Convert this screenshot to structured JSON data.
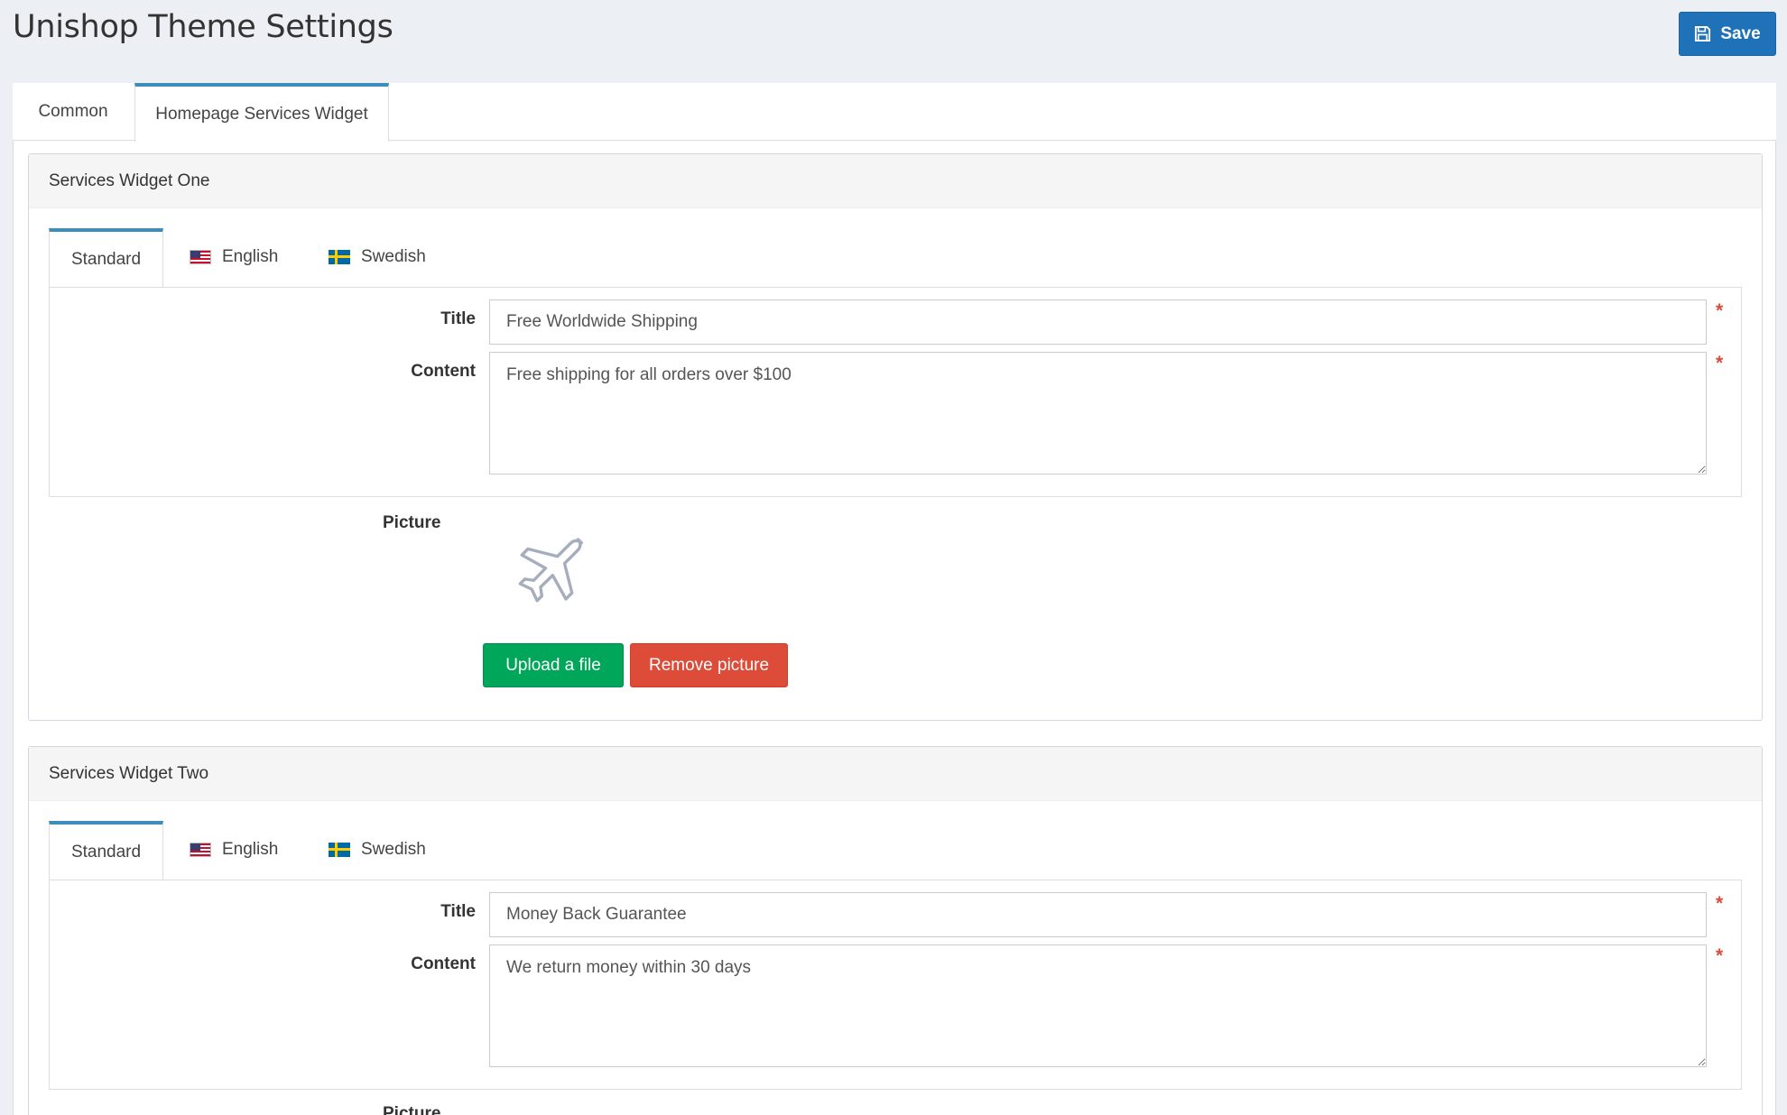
{
  "header": {
    "title": "Unishop Theme Settings",
    "save_label": "Save"
  },
  "tabs": [
    {
      "label": "Common",
      "active": false
    },
    {
      "label": "Homepage Services Widget",
      "active": true
    }
  ],
  "widgets": [
    {
      "heading": "Services Widget One",
      "lang_tabs": [
        "Standard",
        "English",
        "Swedish"
      ],
      "title_label": "Title",
      "title_value": "Free Worldwide Shipping",
      "content_label": "Content",
      "content_value": "Free shipping for all orders over $100",
      "required_mark": "*",
      "picture_label": "Picture",
      "picture_icon": "airplane-icon",
      "upload_label": "Upload a file",
      "remove_label": "Remove picture"
    },
    {
      "heading": "Services Widget Two",
      "lang_tabs": [
        "Standard",
        "English",
        "Swedish"
      ],
      "title_label": "Title",
      "title_value": "Money Back Guarantee",
      "content_label": "Content",
      "content_value": "We return money within 30 days",
      "required_mark": "*",
      "picture_label": "Picture"
    }
  ],
  "colors": {
    "primary": "#1f72b8",
    "tab_accent": "#3c8dbc",
    "success": "#00a65a",
    "danger": "#dd4b39",
    "background": "#ecf0f5"
  }
}
